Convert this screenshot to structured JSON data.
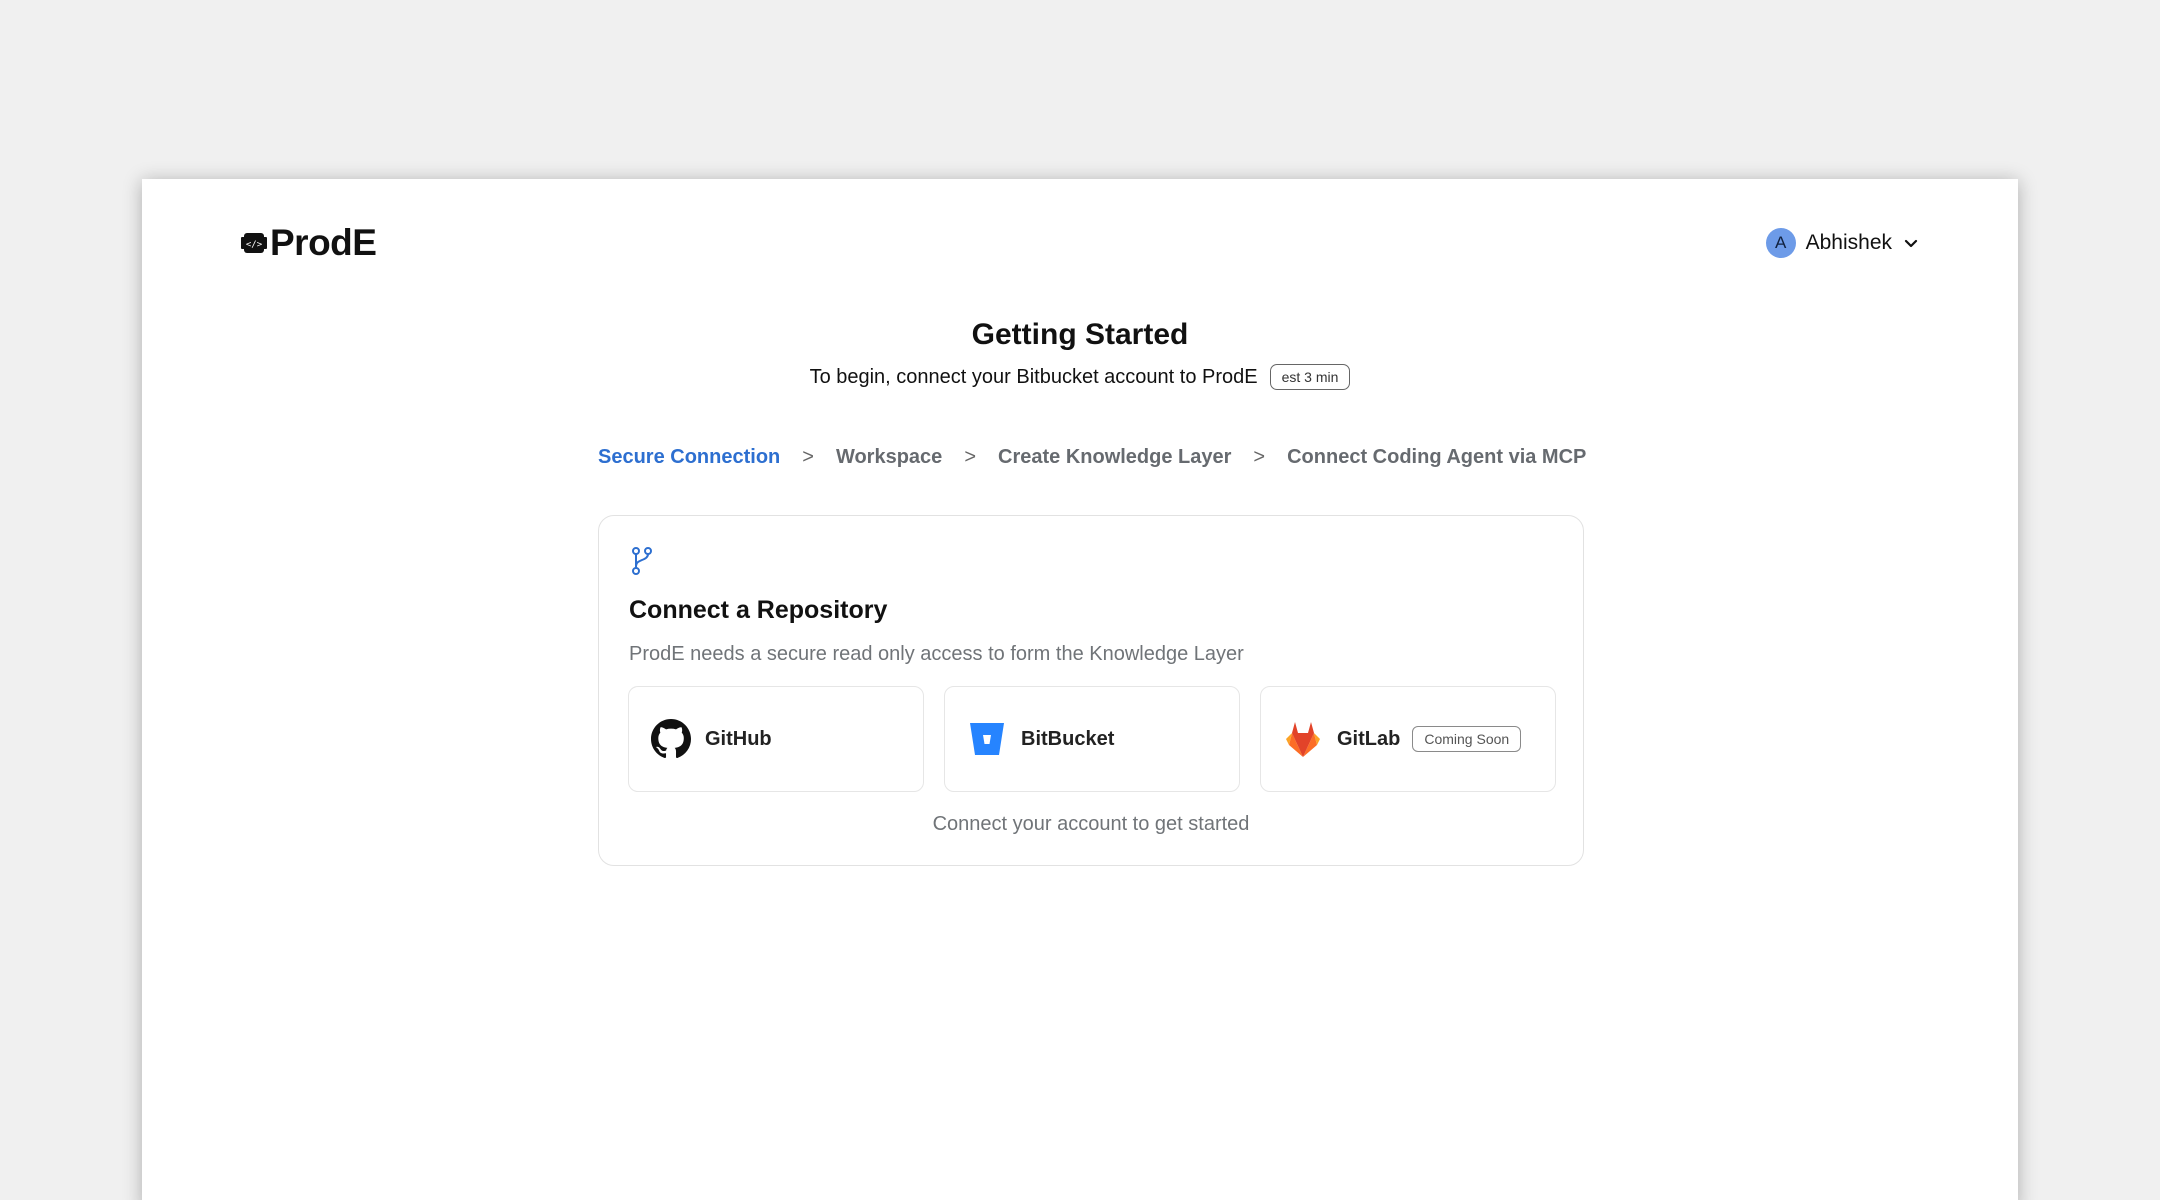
{
  "brand": {
    "name": "ProdE"
  },
  "user": {
    "initial": "A",
    "name": "Abhishek"
  },
  "header": {
    "title": "Getting Started",
    "subtitle": "To begin, connect your Bitbucket account to ProdE",
    "estimate_badge": "est 3 min"
  },
  "steps": [
    {
      "label": "Secure Connection",
      "active": true
    },
    {
      "label": "Workspace",
      "active": false
    },
    {
      "label": "Create Knowledge Layer",
      "active": false
    },
    {
      "label": "Connect Coding Agent via MCP",
      "active": false
    }
  ],
  "steps_separator": ">",
  "card": {
    "icon": "git-branch-icon",
    "title": "Connect a Repository",
    "description": "ProdE needs a secure read only access to form the Knowledge Layer",
    "providers": [
      {
        "label": "GitHub",
        "icon": "github-icon"
      },
      {
        "label": "BitBucket",
        "icon": "bitbucket-icon"
      },
      {
        "label": "GitLab",
        "icon": "gitlab-icon",
        "badge": "Coming Soon"
      }
    ],
    "footer": "Connect your account to get started"
  },
  "colors": {
    "accent": "#2d6fd0",
    "bitbucket": "#2684ff",
    "gitlab_primary": "#e24329",
    "gitlab_secondary": "#fc6d26",
    "gitlab_tertiary": "#fca326",
    "avatar": "#6d9be8"
  }
}
